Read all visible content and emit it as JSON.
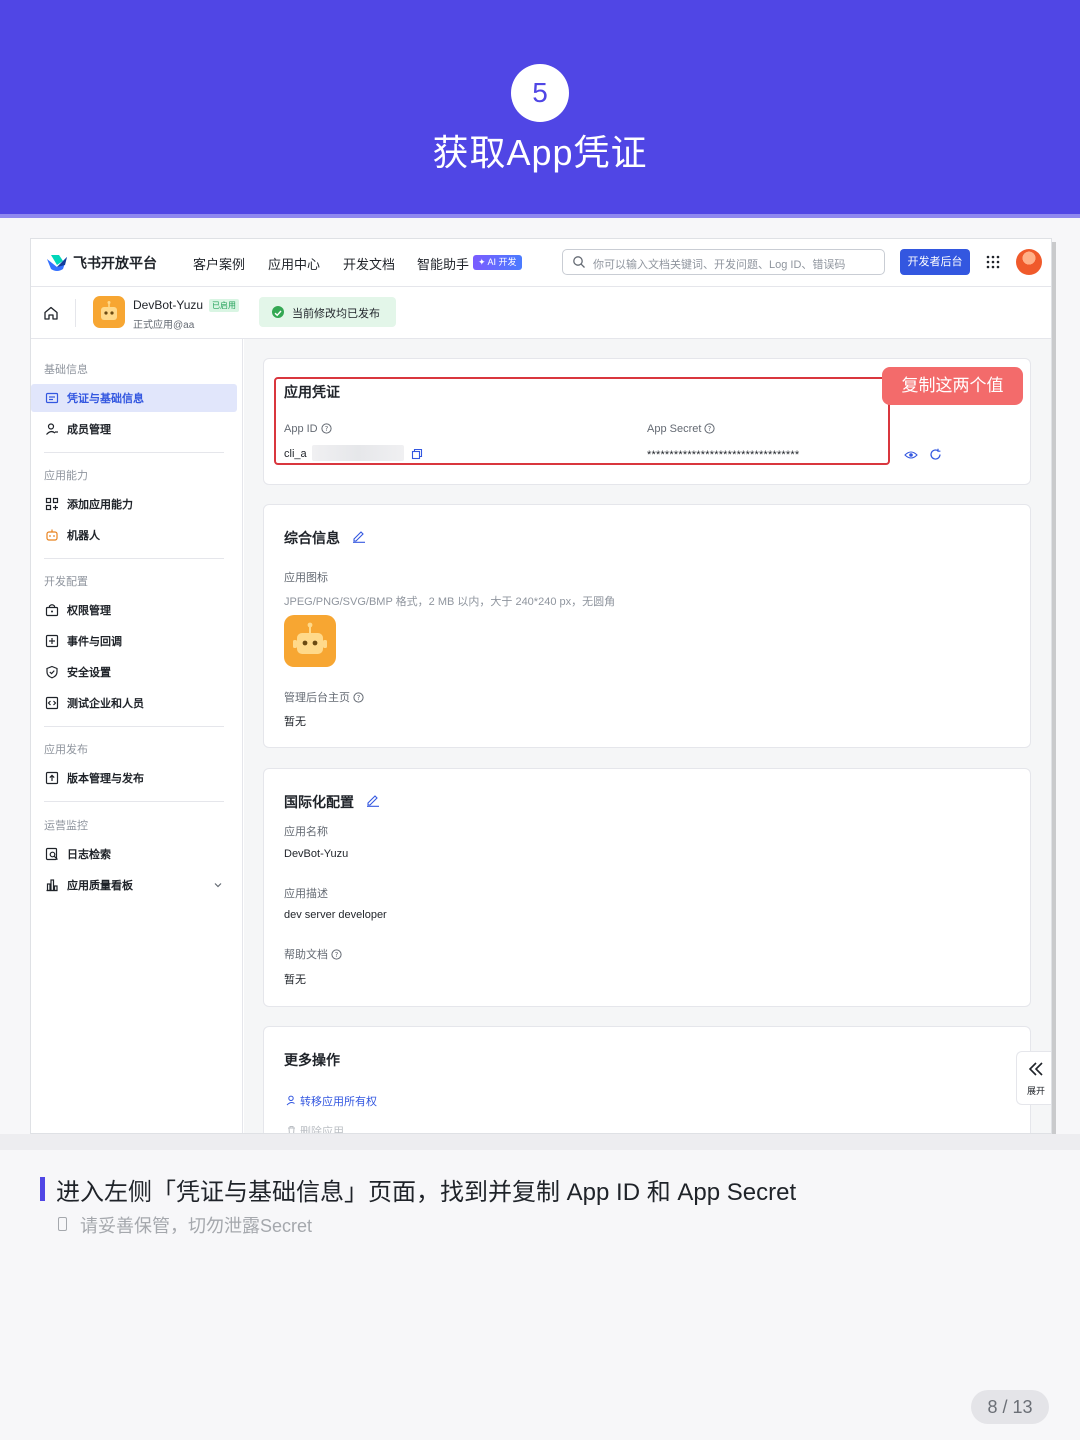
{
  "banner": {
    "step": "5",
    "title": "获取App凭证"
  },
  "nav": {
    "brand": "飞书开放平台",
    "items": [
      "客户案例",
      "应用中心",
      "开发文档",
      "智能助手"
    ],
    "ai_badge": "✦ AI 开发",
    "search_placeholder": "你可以输入文档关键词、开发问题、Log ID、错误码",
    "dev_console": "开发者后台"
  },
  "appbar": {
    "app_name": "DevBot-Yuzu",
    "status_tag": "已启用",
    "owner": "正式应用@aa",
    "publish_status": "当前修改均已发布"
  },
  "sidebar": {
    "sections": [
      {
        "title": "基础信息",
        "items": [
          "凭证与基础信息",
          "成员管理"
        ]
      },
      {
        "title": "应用能力",
        "items": [
          "添加应用能力",
          "机器人"
        ]
      },
      {
        "title": "开发配置",
        "items": [
          "权限管理",
          "事件与回调",
          "安全设置",
          "测试企业和人员"
        ]
      },
      {
        "title": "应用发布",
        "items": [
          "版本管理与发布"
        ]
      },
      {
        "title": "运营监控",
        "items": [
          "日志检索",
          "应用质量看板"
        ]
      }
    ],
    "active": "凭证与基础信息"
  },
  "credentials": {
    "title": "应用凭证",
    "app_id_label": "App ID",
    "app_id_value": "cli_a",
    "app_secret_label": "App Secret",
    "app_secret_value": "**********************************",
    "annotation": "复制这两个值"
  },
  "general": {
    "title": "综合信息",
    "icon_label": "应用图标",
    "icon_hint": "JPEG/PNG/SVG/BMP 格式，2 MB 以内，大于 240*240 px，无圆角",
    "homepage_label": "管理后台主页",
    "homepage_value": "暂无"
  },
  "i18n": {
    "title": "国际化配置",
    "name_label": "应用名称",
    "name_value": "DevBot-Yuzu",
    "desc_label": "应用描述",
    "desc_value": "dev server developer",
    "help_label": "帮助文档",
    "help_value": "暂无"
  },
  "more": {
    "title": "更多操作",
    "transfer": "转移应用所有权",
    "delete": "删除应用"
  },
  "expand_label": "展开",
  "caption": {
    "main": "进入左侧「凭证与基础信息」页面，找到并复制 App ID 和 App Secret",
    "sub": "请妥善保管，切勿泄露Secret"
  },
  "pager": "8 / 13",
  "colors": {
    "banner": "#5046e5",
    "accent": "#3357e0",
    "highlight": "#d9363e"
  }
}
